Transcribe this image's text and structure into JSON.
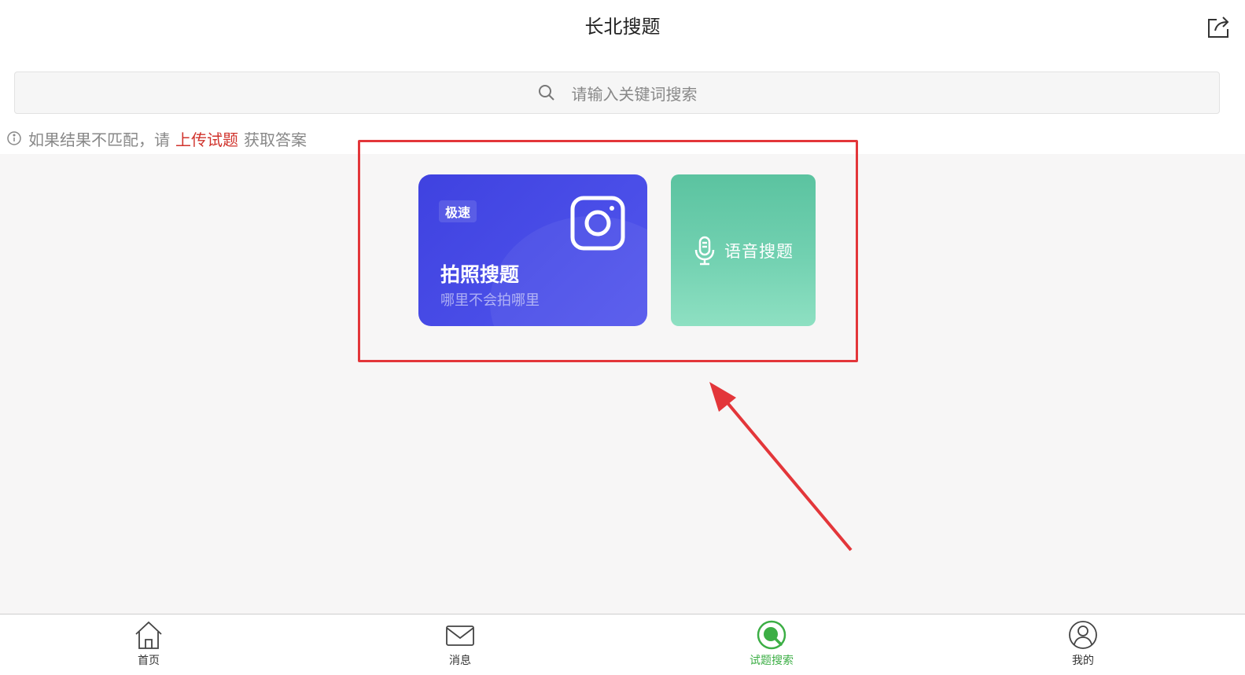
{
  "header": {
    "title": "长北搜题"
  },
  "search": {
    "placeholder": "请输入关键词搜索"
  },
  "hint": {
    "prefix": "如果结果不匹配，请",
    "link": "上传试题",
    "suffix": "获取答案"
  },
  "photo_card": {
    "badge": "极速",
    "title": "拍照搜题",
    "subtitle": "哪里不会拍哪里",
    "icon": "camera-icon"
  },
  "voice_card": {
    "label": "语音搜题",
    "icon": "microphone-icon"
  },
  "tabs": [
    {
      "label": "首页",
      "icon": "home-icon",
      "active": false
    },
    {
      "label": "消息",
      "icon": "mail-icon",
      "active": false
    },
    {
      "label": "试题搜索",
      "icon": "search-icon",
      "active": true
    },
    {
      "label": "我的",
      "icon": "user-icon",
      "active": false
    }
  ],
  "colors": {
    "accent_green": "#3cae45",
    "link_red": "#d0332c",
    "photo_card": "#4447e3",
    "voice_card": "#6fd0ae",
    "highlight": "#e3363a"
  }
}
